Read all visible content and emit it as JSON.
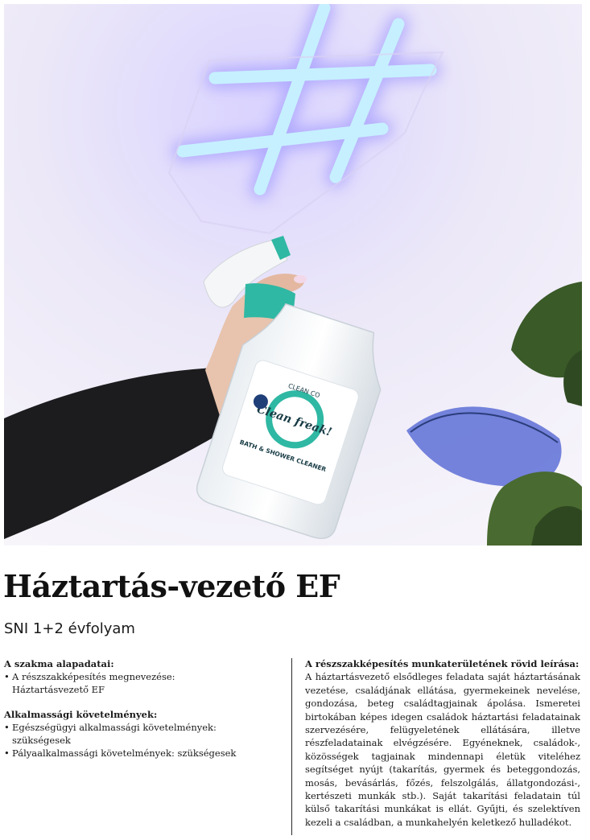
{
  "photo": {
    "label_brand": "CLEAN CO",
    "label_product": "Clean freak!",
    "label_type": "BATH & SHOWER CLEANER",
    "colors": {
      "wall": "#f2eef8",
      "neon": "#bfe9ff",
      "accent": "#2fb8a3",
      "sleeve": "#1b1b1b",
      "leaf": "#3e5a2c"
    }
  },
  "header": {
    "title": "Háztartás-vezető EF",
    "subtitle": "SNI 1+2 évfolyam"
  },
  "left": {
    "sections": [
      {
        "heading": "A szakma alapadatai:",
        "items": [
          {
            "label": "A részszakképesítés megnevezése:",
            "value": "Háztartásvezető EF"
          }
        ]
      },
      {
        "heading": "Alkalmassági követelmények:",
        "items": [
          {
            "label": "Egészségügyi alkalmassági követelmények:",
            "value": "szükségesek"
          },
          {
            "label": "Pályaalkalmassági követelmények: szükségesek",
            "value": ""
          }
        ]
      }
    ]
  },
  "right": {
    "heading": "A részszakképesítés munkaterületének rövid leírása:",
    "body": "A háztartásvezető elsődleges feladata saját háztartásának vezetése, családjának ellátása, gyermekeinek nevelése, gondozása, beteg családtagjainak ápolása. Ismeretei birtokában képes idegen családok háztartási feladatainak szervezésére, felügyeletének ellátására, illetve részfeladatainak elvégzésére. Egyéneknek, családok-, közösségek tagjainak mindennapi életük viteléhez segítséget nyújt (takarítás, gyermek és beteggondozás, mosás, bevásárlás, főzés, felszolgálás, állatgondozási-, kertészeti munkák stb.). Saját takarítási feladatain túl külső takarítási munkákat is ellát. Gyűjti, és szelektíven kezeli a családban, a munkahelyén keletkező hulladékot."
  }
}
